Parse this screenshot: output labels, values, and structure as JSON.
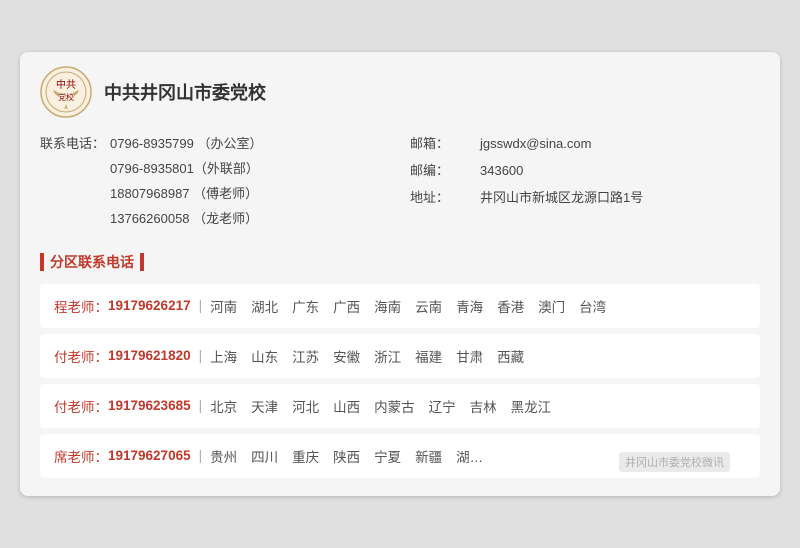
{
  "org": {
    "name": "中共井冈山市委党校",
    "logo_alt": "党校徽章"
  },
  "contact": {
    "label_phone": "联系电话：",
    "phones": [
      {
        "number": "0796-8935799",
        "note": "（办公室）"
      },
      {
        "number": "0796-8935801",
        "note": "（外联部）"
      },
      {
        "number": "18807968987",
        "note": "（傅老师）"
      },
      {
        "number": "13766260058",
        "note": "（龙老师）"
      }
    ],
    "label_email": "邮箱：",
    "email": "jgsswdx@sina.com",
    "label_postcode": "邮编：",
    "postcode": "343600",
    "label_address": "地址：",
    "address": "井冈山市新城区龙源口路1号"
  },
  "section_title": "分区联系电话",
  "regions": [
    {
      "teacher": "程老师：",
      "phone": "19179626217",
      "areas": [
        "河南",
        "湖北",
        "广东",
        "广西",
        "海南",
        "云南",
        "青海",
        "香港",
        "澳门",
        "台湾"
      ]
    },
    {
      "teacher": "付老师：",
      "phone": "19179621820",
      "areas": [
        "上海",
        "山东",
        "江苏",
        "安徽",
        "浙江",
        "福建",
        "甘肃",
        "西藏"
      ]
    },
    {
      "teacher": "付老师：",
      "phone": "19179623685",
      "areas": [
        "北京",
        "天津",
        "河北",
        "山西",
        "内蒙古",
        "辽宁",
        "吉林",
        "黑龙江"
      ]
    },
    {
      "teacher": "席老师：",
      "phone": "19179627065",
      "areas": [
        "贵州",
        "四川",
        "重庆",
        "陕西",
        "宁夏",
        "新疆",
        "湖…"
      ]
    }
  ],
  "watermark": "井冈山市委党校微讯"
}
